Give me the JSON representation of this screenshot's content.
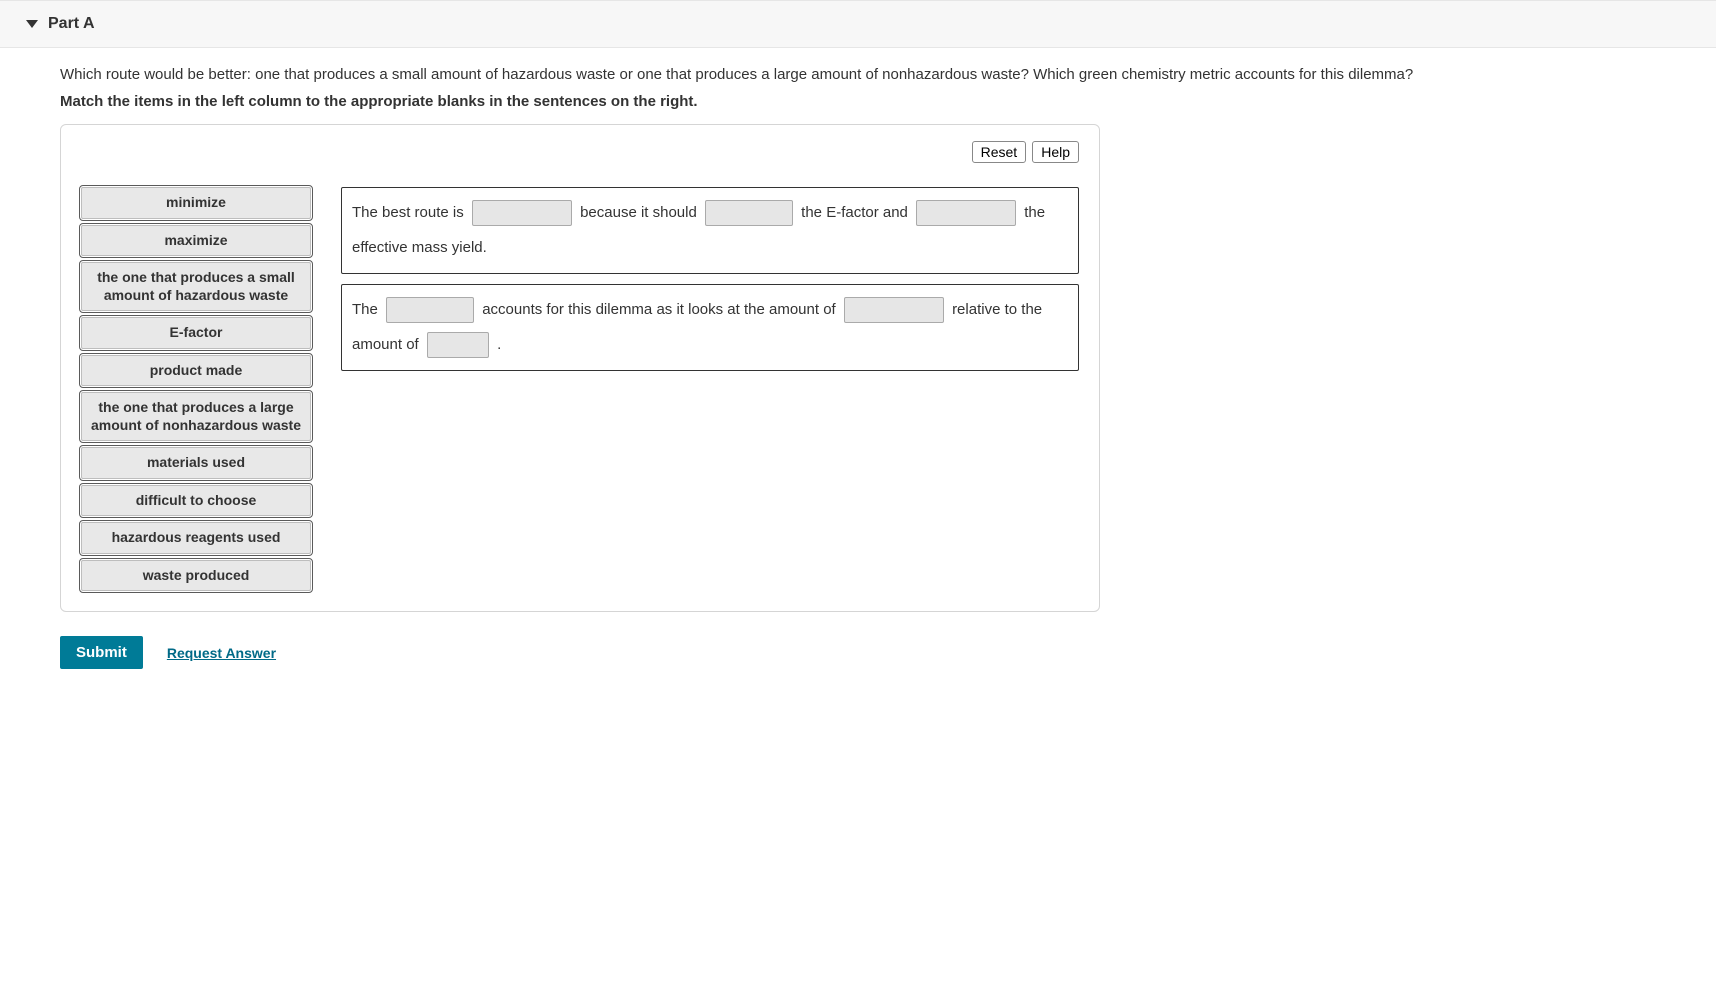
{
  "part": {
    "title": "Part A"
  },
  "question": "Which route would be better: one that produces a small amount of hazardous waste or one that produces a large amount of nonhazardous waste? Which green chemistry metric accounts for this dilemma?",
  "instruction": "Match the items in the left column to the appropriate blanks in the sentences on the right.",
  "toolbar": {
    "reset": "Reset",
    "help": "Help"
  },
  "draggables": [
    "minimize",
    "maximize",
    "the one that produces a small amount of hazardous waste",
    "E-factor",
    "product made",
    "the one that produces a large amount of nonhazardous waste",
    "materials used",
    "difficult to choose",
    "hazardous reagents used",
    "waste produced"
  ],
  "sentence1": {
    "t0": "The best route is",
    "t1": "because it should",
    "t2": "the E-factor and",
    "t3": "the effective mass yield."
  },
  "sentence2": {
    "t0": "The",
    "t1": "accounts for this dilemma as it looks at the amount of",
    "t2": "relative to",
    "t3": "the amount of",
    "t4": "."
  },
  "actions": {
    "submit": "Submit",
    "request": "Request Answer"
  }
}
